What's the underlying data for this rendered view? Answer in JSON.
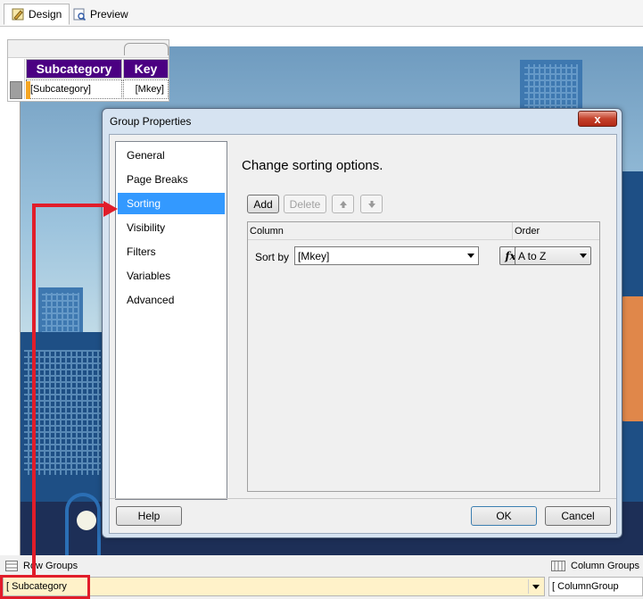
{
  "tabs": [
    {
      "label": "Design",
      "icon": "design-icon",
      "active": true
    },
    {
      "label": "Preview",
      "icon": "preview-icon",
      "active": false
    }
  ],
  "tablix": {
    "header1": "Subcategory",
    "header2": "Key",
    "cell1": "[Subcategory]",
    "cell2": "[Mkey]",
    "header_color": "#4b0082"
  },
  "dialog": {
    "title": "Group Properties",
    "close_glyph": "x",
    "nav_items": [
      "General",
      "Page Breaks",
      "Sorting",
      "Visibility",
      "Filters",
      "Variables",
      "Advanced"
    ],
    "selected_nav": "Sorting",
    "heading": "Change sorting options.",
    "toolbar": {
      "add": "Add",
      "delete": "Delete"
    },
    "grid": {
      "col_column": "Column",
      "col_order": "Order",
      "rows": [
        {
          "label": "Sort by",
          "column": "[Mkey]",
          "order": "A to Z"
        }
      ]
    },
    "buttons": {
      "help": "Help",
      "ok": "OK",
      "cancel": "Cancel"
    }
  },
  "bottom": {
    "row_groups_label": "Row Groups",
    "column_groups_label": "Column Groups",
    "row_group_item": "Subcategory",
    "column_group_item": "ColumnGroup"
  },
  "colors": {
    "selection": "#3399ff",
    "annotation": "#e11d2a",
    "group_row_bg": "#fff2c9"
  }
}
